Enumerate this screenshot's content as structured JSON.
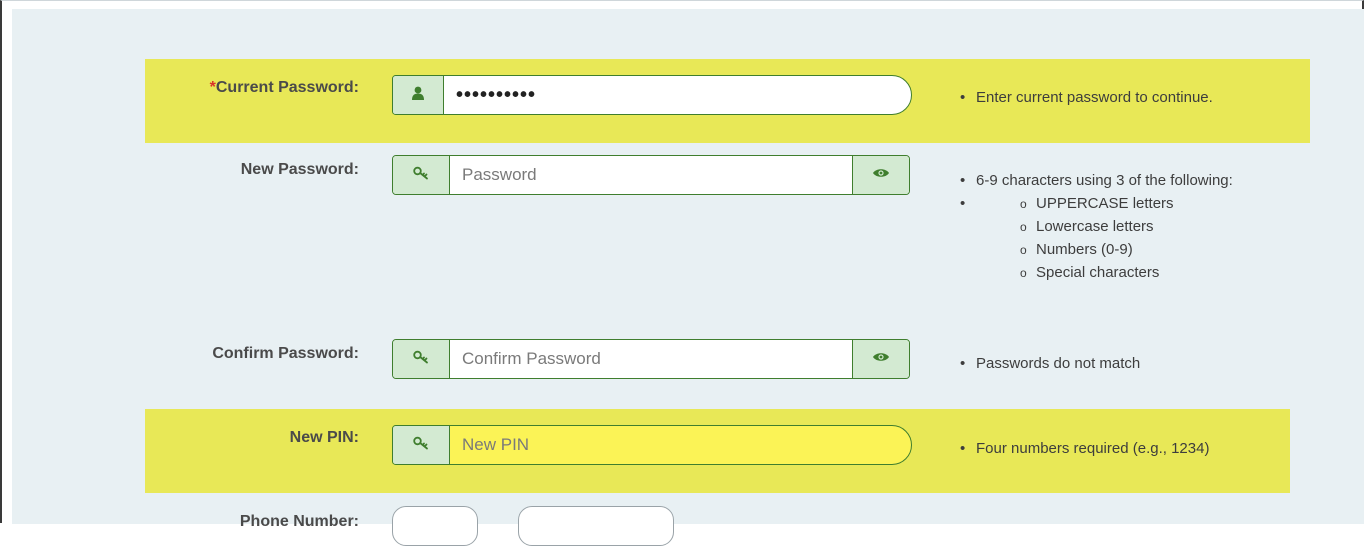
{
  "current_password": {
    "required_mark": "*",
    "label": "Current Password:",
    "value": "••••••••••",
    "icon": "user-icon",
    "hint": "Enter current password to continue."
  },
  "new_password": {
    "label": "New Password:",
    "placeholder": "Password",
    "icon": "key-icon",
    "toggle_icon": "eye-icon",
    "hints": [
      "6-9 characters using 3 of the following:",
      ""
    ],
    "sub_hints": [
      "UPPERCASE letters",
      "Lowercase letters",
      "Numbers (0-9)",
      "Special characters"
    ]
  },
  "confirm_password": {
    "label": "Confirm Password:",
    "placeholder": "Confirm Password",
    "icon": "key-icon",
    "toggle_icon": "eye-icon",
    "hint": "Passwords do not match"
  },
  "new_pin": {
    "label": "New PIN:",
    "placeholder": "New PIN",
    "icon": "key-icon",
    "hint": "Four numbers required (e.g., 1234)"
  },
  "phone_number": {
    "label": "Phone Number:"
  },
  "colors": {
    "highlight_band": "#e8e857",
    "accent_green": "#3f7e2e",
    "addon_bg": "#d3ead2",
    "required": "#d9332b"
  }
}
